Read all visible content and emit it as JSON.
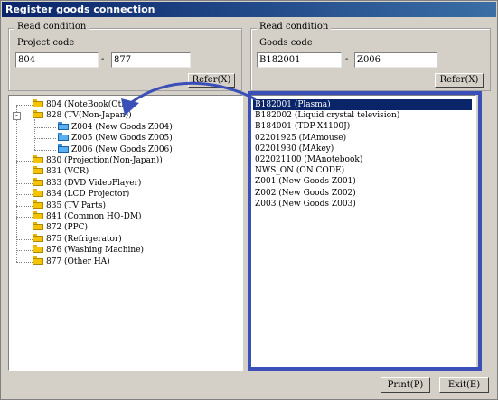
{
  "window": {
    "title": "Register goods connection"
  },
  "left_group": {
    "title": "Read condition",
    "label": "Project code",
    "from_value": "804",
    "separator": "-",
    "to_value": "877",
    "refer_label": "Refer(X)"
  },
  "right_group": {
    "title": "Read condition",
    "label": "Goods code",
    "from_value": "B182001",
    "separator": "-",
    "to_value": "Z006",
    "refer_label": "Refer(X)"
  },
  "tree": {
    "nodes": [
      {
        "label": "804  (NoteBook(Oth",
        "level": 0,
        "icon": "folder-icon"
      },
      {
        "label": "828  (TV(Non-Japan))",
        "level": 0,
        "icon": "folder-icon",
        "expanded": true,
        "expander": "-"
      },
      {
        "label": "Z004  (New Goods Z004)",
        "level": 1,
        "icon": "blue-folder-icon"
      },
      {
        "label": "Z005  (New Goods Z005)",
        "level": 1,
        "icon": "blue-folder-icon"
      },
      {
        "label": "Z006  (New Goods Z006)",
        "level": 1,
        "icon": "blue-folder-icon"
      },
      {
        "label": "830  (Projection(Non-Japan))",
        "level": 0,
        "icon": "folder-icon"
      },
      {
        "label": "831  (VCR)",
        "level": 0,
        "icon": "folder-icon"
      },
      {
        "label": "833  (DVD VideoPlayer)",
        "level": 0,
        "icon": "folder-icon"
      },
      {
        "label": "834  (LCD Projector)",
        "level": 0,
        "icon": "folder-icon"
      },
      {
        "label": "835  (TV Parts)",
        "level": 0,
        "icon": "folder-icon"
      },
      {
        "label": "841  (Common HQ-DM)",
        "level": 0,
        "icon": "folder-icon"
      },
      {
        "label": "872  (PPC)",
        "level": 0,
        "icon": "folder-icon"
      },
      {
        "label": "875  (Refrigerator)",
        "level": 0,
        "icon": "folder-icon"
      },
      {
        "label": "876  (Washing Machine)",
        "level": 0,
        "icon": "folder-icon"
      },
      {
        "label": "877  (Other HA)",
        "level": 0,
        "icon": "folder-icon"
      }
    ]
  },
  "goods_list": {
    "items": [
      {
        "label": "B182001  (Plasma)",
        "selected": true
      },
      {
        "label": "B182002  (Liquid crystal television)"
      },
      {
        "label": "B184001  (TDP-X4100J)"
      },
      {
        "label": "02201925  (MAmouse)"
      },
      {
        "label": "02201930  (MAkey)"
      },
      {
        "label": "022021100  (MAnotebook)"
      },
      {
        "label": "NWS_ON  (ON CODE)"
      },
      {
        "label": "Z001  (New Goods Z001)"
      },
      {
        "label": "Z002  (New Goods Z002)"
      },
      {
        "label": "Z003  (New Goods Z003)"
      }
    ]
  },
  "footer": {
    "print_label": "Print(P)",
    "exit_label": "Exit(E)"
  },
  "colors": {
    "annotation": "#3a4fb8",
    "title_bar": "#0a246a",
    "selection": "#0a246a"
  }
}
